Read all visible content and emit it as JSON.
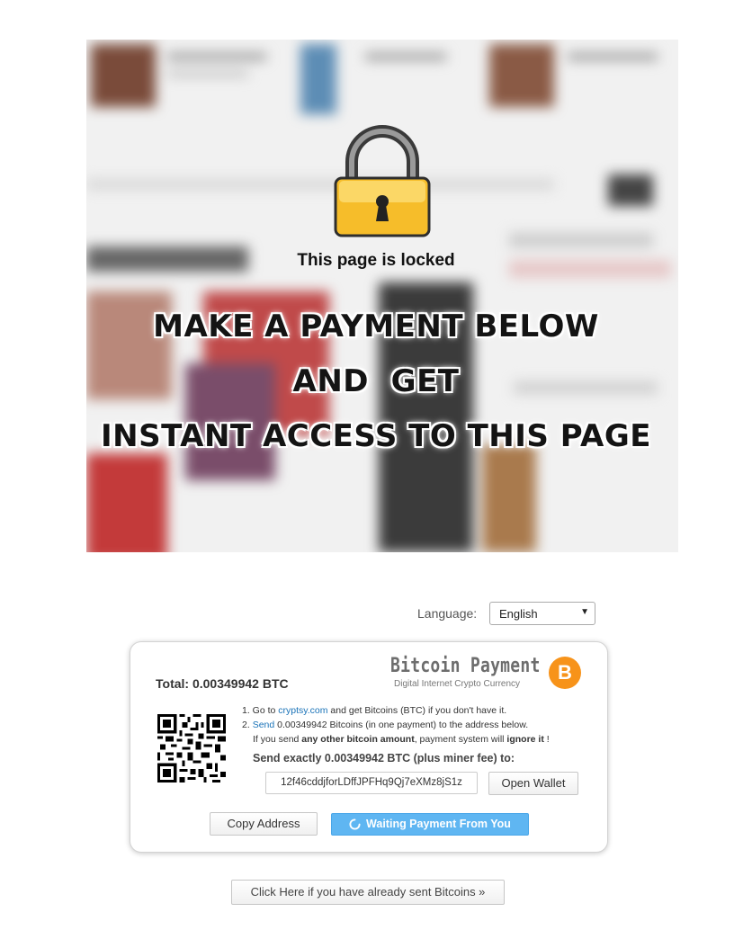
{
  "lock_screen": {
    "locked_text": "This page is locked",
    "headline_1": "MAKE A PAYMENT BELOW",
    "headline_2": "AND  GET",
    "headline_3": "INSTANT ACCESS TO THIS PAGE"
  },
  "language": {
    "label": "Language:",
    "selected": "English"
  },
  "payment": {
    "total_label": "Total:",
    "total_amount": "0.00349942",
    "total_currency": "BTC",
    "brand_title": "Bitcoin Payment",
    "brand_subtitle": "Digital Internet Crypto Currency",
    "brand_logo_symbol": "B",
    "step1_prefix": "1. Go to ",
    "step1_link": "cryptsy.com",
    "step1_suffix": " and get Bitcoins (BTC) if you don't have it.",
    "step2_prefix": "2. ",
    "step2_link": "Send",
    "step2_suffix": " 0.00349942 Bitcoins (in one payment) to the address below.",
    "step2_note_a": "If you send ",
    "step2_note_b": "any other bitcoin amount",
    "step2_note_c": ", payment system will ",
    "step2_note_d": "ignore it",
    "step2_note_e": " !",
    "send_exact": "Send exactly 0.00349942 BTC (plus miner fee) to:",
    "address": "12f46cddjforLDffJPFHq9Qj7eXMz8jS1z",
    "open_wallet_label": "Open Wallet",
    "copy_address_label": "Copy Address",
    "waiting_label": "Waiting Payment From You",
    "already_sent_label": "Click Here if you have already sent Bitcoins »"
  },
  "colors": {
    "btc_orange": "#f7931a",
    "waiting_blue": "#5fb6f2",
    "link_blue": "#1a73b8"
  }
}
